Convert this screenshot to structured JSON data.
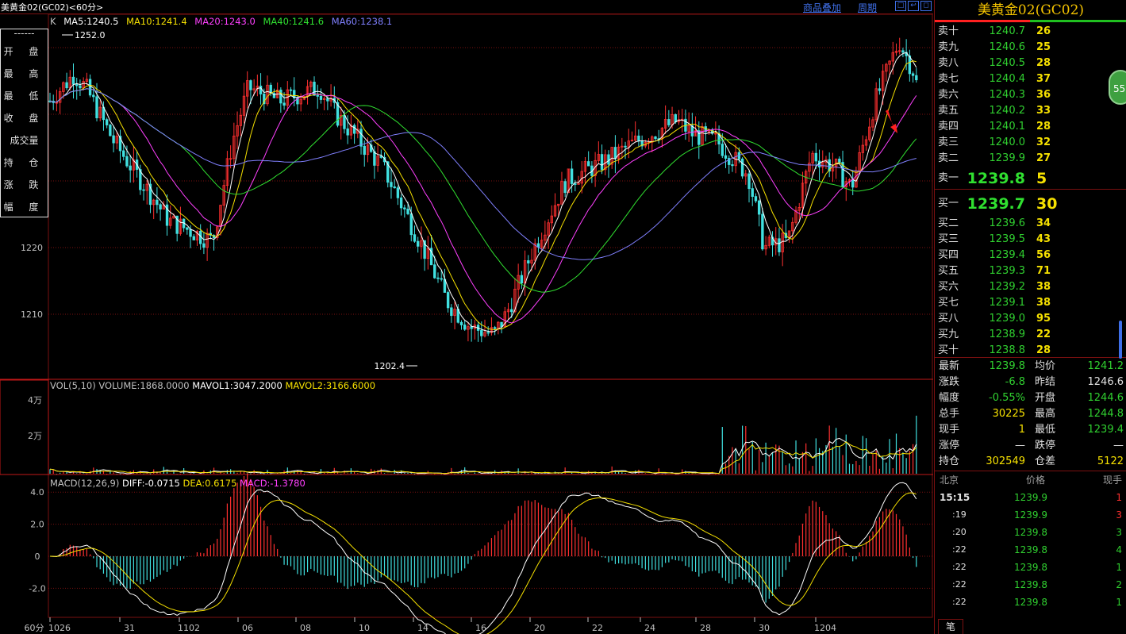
{
  "header": {
    "title": "美黄金02(GC02)<60分>",
    "links": [
      "商品叠加",
      "周期"
    ],
    "window_buttons": [
      "restore-icon",
      "back-icon",
      "fullscreen-icon"
    ]
  },
  "info_box": {
    "dash_top": "------",
    "rows": [
      "开  盘",
      "最  高",
      "最  低",
      "收  盘",
      "成交量",
      "持  仓",
      "涨  跌",
      "幅  度"
    ]
  },
  "ma_legend": {
    "prefix": "K",
    "items": [
      {
        "text": "MA5:1240.5",
        "color": "#ffffff"
      },
      {
        "text": "MA10:1241.4",
        "color": "#f5e000"
      },
      {
        "text": "MA20:1243.0",
        "color": "#ff40ff"
      },
      {
        "text": "MA40:1241.6",
        "color": "#30e030"
      },
      {
        "text": "MA60:1238.1",
        "color": "#8080ff"
      }
    ]
  },
  "price_labels": {
    "high": "1252.0",
    "low": "1202.4"
  },
  "price_axis": [
    "1220",
    "1210"
  ],
  "vol_panel": {
    "legend_prefix": "VOL(5,10)",
    "volume": "VOLUME:1868.0000",
    "mavol1": "MAVOL1:3047.2000",
    "mavol2": "MAVOL2:3166.6000",
    "axis": [
      "4万",
      "2万"
    ]
  },
  "macd_panel": {
    "legend_prefix": "MACD(12,26,9)",
    "diff": "DIFF:-0.0715",
    "dea": "DEA:0.6175",
    "macd": "MACD:-1.3780",
    "axis": [
      "4.0",
      "2.0",
      "0",
      "-2.0"
    ]
  },
  "x_axis": {
    "period": "60分",
    "labels": [
      "1026",
      "31",
      "1102",
      "06",
      "08",
      "10",
      "14",
      "16",
      "20",
      "22",
      "24",
      "28",
      "30",
      "1204"
    ]
  },
  "side": {
    "title": "美黄金02(GC02)",
    "sells": [
      {
        "label": "卖十",
        "price": "1240.7",
        "vol": "26"
      },
      {
        "label": "卖九",
        "price": "1240.6",
        "vol": "25"
      },
      {
        "label": "卖八",
        "price": "1240.5",
        "vol": "28"
      },
      {
        "label": "卖七",
        "price": "1240.4",
        "vol": "37"
      },
      {
        "label": "卖六",
        "price": "1240.3",
        "vol": "36"
      },
      {
        "label": "卖五",
        "price": "1240.2",
        "vol": "33"
      },
      {
        "label": "卖四",
        "price": "1240.1",
        "vol": "28"
      },
      {
        "label": "卖三",
        "price": "1240.0",
        "vol": "32"
      },
      {
        "label": "卖二",
        "price": "1239.9",
        "vol": "27"
      }
    ],
    "sell1": {
      "label": "卖一",
      "price": "1239.8",
      "vol": "5"
    },
    "buy1": {
      "label": "买一",
      "price": "1239.7",
      "vol": "30"
    },
    "buys": [
      {
        "label": "买二",
        "price": "1239.6",
        "vol": "34"
      },
      {
        "label": "买三",
        "price": "1239.5",
        "vol": "43"
      },
      {
        "label": "买四",
        "price": "1239.4",
        "vol": "56"
      },
      {
        "label": "买五",
        "price": "1239.3",
        "vol": "71"
      },
      {
        "label": "买六",
        "price": "1239.2",
        "vol": "38"
      },
      {
        "label": "买七",
        "price": "1239.1",
        "vol": "38"
      },
      {
        "label": "买八",
        "price": "1239.0",
        "vol": "95"
      },
      {
        "label": "买九",
        "price": "1238.9",
        "vol": "22"
      },
      {
        "label": "买十",
        "price": "1238.8",
        "vol": "28"
      }
    ],
    "stats_left": [
      {
        "label": "最新",
        "value": "1239.8",
        "color": "#30d030"
      },
      {
        "label": "涨跌",
        "value": "-6.8",
        "color": "#30d030"
      },
      {
        "label": "幅度",
        "value": "-0.55%",
        "color": "#30d030"
      },
      {
        "label": "总手",
        "value": "30225",
        "color": "#f5e000"
      },
      {
        "label": "现手",
        "value": "1",
        "color": "#f5e000"
      },
      {
        "label": "涨停",
        "value": "—",
        "color": "#e0e0e0"
      },
      {
        "label": "持仓",
        "value": "302549",
        "color": "#f5e000"
      }
    ],
    "stats_right": [
      {
        "label": "均价",
        "value": "1241.2",
        "color": "#30d030"
      },
      {
        "label": "昨结",
        "value": "1246.6",
        "color": "#e0e0e0"
      },
      {
        "label": "开盘",
        "value": "1244.6",
        "color": "#30d030"
      },
      {
        "label": "最高",
        "value": "1244.8",
        "color": "#30d030"
      },
      {
        "label": "最低",
        "value": "1239.4",
        "color": "#30d030"
      },
      {
        "label": "跌停",
        "value": "—",
        "color": "#e0e0e0"
      },
      {
        "label": "仓差",
        "value": "5122",
        "color": "#f5e000"
      }
    ],
    "ticks_header": {
      "place": "北京",
      "price": "价格",
      "qty": "现手"
    },
    "ticks": [
      {
        "t": "15:15",
        "p": "1239.9",
        "q": "1"
      },
      {
        "t": ":19",
        "p": "1239.9",
        "q": "3"
      },
      {
        "t": ":20",
        "p": "1239.8",
        "q": "3"
      },
      {
        "t": ":22",
        "p": "1239.8",
        "q": "4"
      },
      {
        "t": ":22",
        "p": "1239.8",
        "q": "1"
      },
      {
        "t": ":22",
        "p": "1239.8",
        "q": "2"
      },
      {
        "t": ":22",
        "p": "1239.8",
        "q": "1"
      }
    ],
    "ball_text": "55",
    "tab": "笔"
  },
  "colors": {
    "up": "#ff3030",
    "down": "#40e0e0",
    "grid": "#7a1010",
    "axis": "#c0c0c0"
  }
}
